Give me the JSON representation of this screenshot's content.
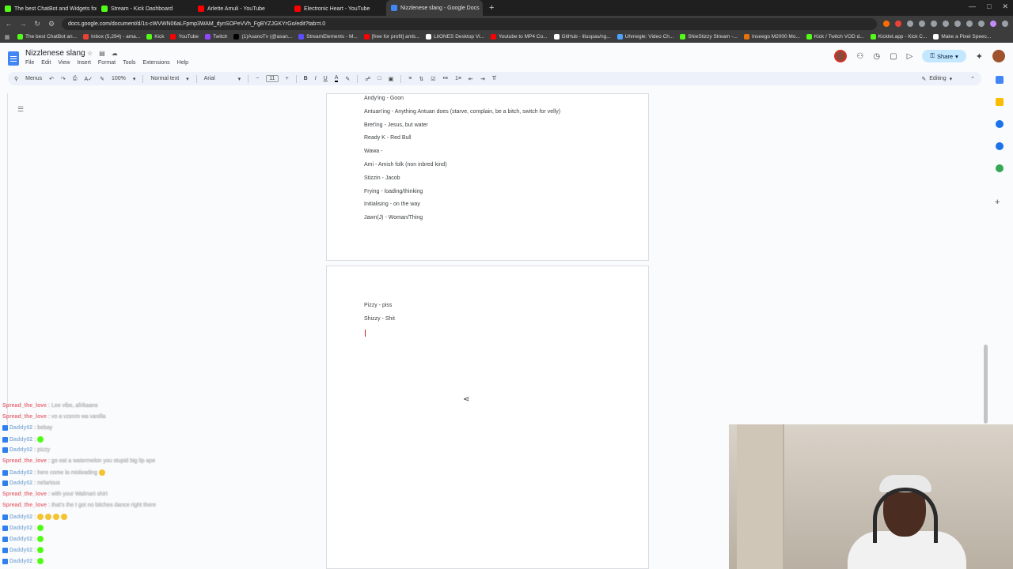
{
  "browser": {
    "tabs": [
      {
        "title": "The best ChatBot and Widgets for K",
        "color": "#53fc18"
      },
      {
        "title": "Stream - Kick Dashboard",
        "color": "#53fc18"
      },
      {
        "title": "Arlette Amuli - YouTube",
        "color": "#ff0000"
      },
      {
        "title": "Electronic Heart - YouTube",
        "color": "#ff0000"
      },
      {
        "title": "Nizzlenese slang - Google Docs",
        "color": "#4285f4",
        "active": true
      }
    ],
    "url": "docs.google.com/document/d/1s-cWVWN06aLFpmp3WAM_dynSOPeVVh_FgBYZJGKYrGo/edit?tab=t.0",
    "bookmarks": [
      {
        "label": "The best ChatBot an...",
        "color": "#53fc18"
      },
      {
        "label": "Inbox (5,294) - ama...",
        "color": "#ea4335"
      },
      {
        "label": "Kick",
        "color": "#53fc18"
      },
      {
        "label": "YouTube",
        "color": "#ff0000"
      },
      {
        "label": "Twitch",
        "color": "#9146ff"
      },
      {
        "label": "(1)AsanoTv (@asan...",
        "color": "#000000"
      },
      {
        "label": "StreamElements - M...",
        "color": "#5b4fff"
      },
      {
        "label": "[free for profit] amb...",
        "color": "#ff0000"
      },
      {
        "label": "LitONES Desktop Vi...",
        "color": "#ffffff"
      },
      {
        "label": "Youtube to MP4 Co...",
        "color": "#ff0000"
      },
      {
        "label": "GitHub - illuspas/ng...",
        "color": "#ffffff"
      },
      {
        "label": "Uhmegle: Video Ch...",
        "color": "#4da3ff"
      },
      {
        "label": "ShieStizzy Stream -...",
        "color": "#53fc18"
      },
      {
        "label": "Inseego M2000 Mo...",
        "color": "#e8710a"
      },
      {
        "label": "Kick / Twitch VOD d...",
        "color": "#53fc18"
      },
      {
        "label": "Kicklet.app - Kick C...",
        "color": "#53fc18"
      },
      {
        "label": "Make a Pixel Speec...",
        "color": "#ffffff"
      }
    ]
  },
  "docs": {
    "title": "Nizzlenese slang",
    "menu": [
      "File",
      "Edit",
      "View",
      "Insert",
      "Format",
      "Tools",
      "Extensions",
      "Help"
    ],
    "share_label": "Share",
    "toolbar": {
      "menus_label": "Menus",
      "zoom": "100%",
      "style": "Normal text",
      "font": "Arial",
      "font_size": "11",
      "mode": "Editing"
    }
  },
  "document": {
    "page1_lines": [
      "Andy'ing - Goon",
      "Antuan'ing - Anything Antuan does (starve, complain, be a bitch, switch for velly)",
      "Bret'ing - Jesus, but water",
      "Ready K - Red Bull",
      "Wawa -",
      "Ami - Amish folk (non inbred kind)",
      "Stizzin - Jacob",
      "Frying - loading/thinking",
      "Initialising - on the way",
      "Jawn(J) - Woman/Thing"
    ],
    "page2_lines": [
      "Pizzy - piss",
      "Shizzy - Shit"
    ]
  },
  "chat": [
    {
      "name": "Spread_the_love",
      "color": "#e8717b",
      "badge": false,
      "msg": "Lee vibe, afrikaans"
    },
    {
      "name": "Spread_the_love",
      "color": "#e8717b",
      "badge": false,
      "msg": "vo a vzenm wa vanilla"
    },
    {
      "name": "Daddy02",
      "color": "#8fb3d9",
      "badge": true,
      "msg": "bebay"
    },
    {
      "name": "Daddy02",
      "color": "#8fb3d9",
      "badge": true,
      "msg": "",
      "emoji": [
        "#53fc18"
      ]
    },
    {
      "name": "Daddy02",
      "color": "#8fb3d9",
      "badge": true,
      "msg": "pizzy"
    },
    {
      "name": "Spread_the_love",
      "color": "#e8717b",
      "badge": false,
      "msg": "go eat a watermelon you stupid big lip ape"
    },
    {
      "name": "Daddy02",
      "color": "#8fb3d9",
      "badge": true,
      "msg": "here come la misleading",
      "emoji": [
        "#f4c430"
      ]
    },
    {
      "name": "Daddy02",
      "color": "#8fb3d9",
      "badge": true,
      "msg": "nefarious"
    },
    {
      "name": "Spread_the_love",
      "color": "#e8717b",
      "badge": false,
      "msg": "with your Walmart shirt"
    },
    {
      "name": "Spread_the_love",
      "color": "#e8717b",
      "badge": false,
      "msg": "that's the I got no bitches dance right there"
    },
    {
      "name": "Daddy02",
      "color": "#8fb3d9",
      "badge": true,
      "msg": "",
      "emoji": [
        "#f4c430",
        "#f4c430",
        "#f4c430",
        "#f4c430"
      ]
    },
    {
      "name": "Daddy02",
      "color": "#8fb3d9",
      "badge": true,
      "msg": "",
      "emoji": [
        "#53fc18"
      ]
    },
    {
      "name": "Daddy02",
      "color": "#8fb3d9",
      "badge": true,
      "msg": "",
      "emoji": [
        "#53fc18"
      ]
    },
    {
      "name": "Daddy02",
      "color": "#8fb3d9",
      "badge": true,
      "msg": "",
      "emoji": [
        "#53fc18"
      ]
    },
    {
      "name": "Daddy02",
      "color": "#8fb3d9",
      "badge": true,
      "msg": "",
      "emoji": [
        "#53fc18"
      ]
    }
  ]
}
